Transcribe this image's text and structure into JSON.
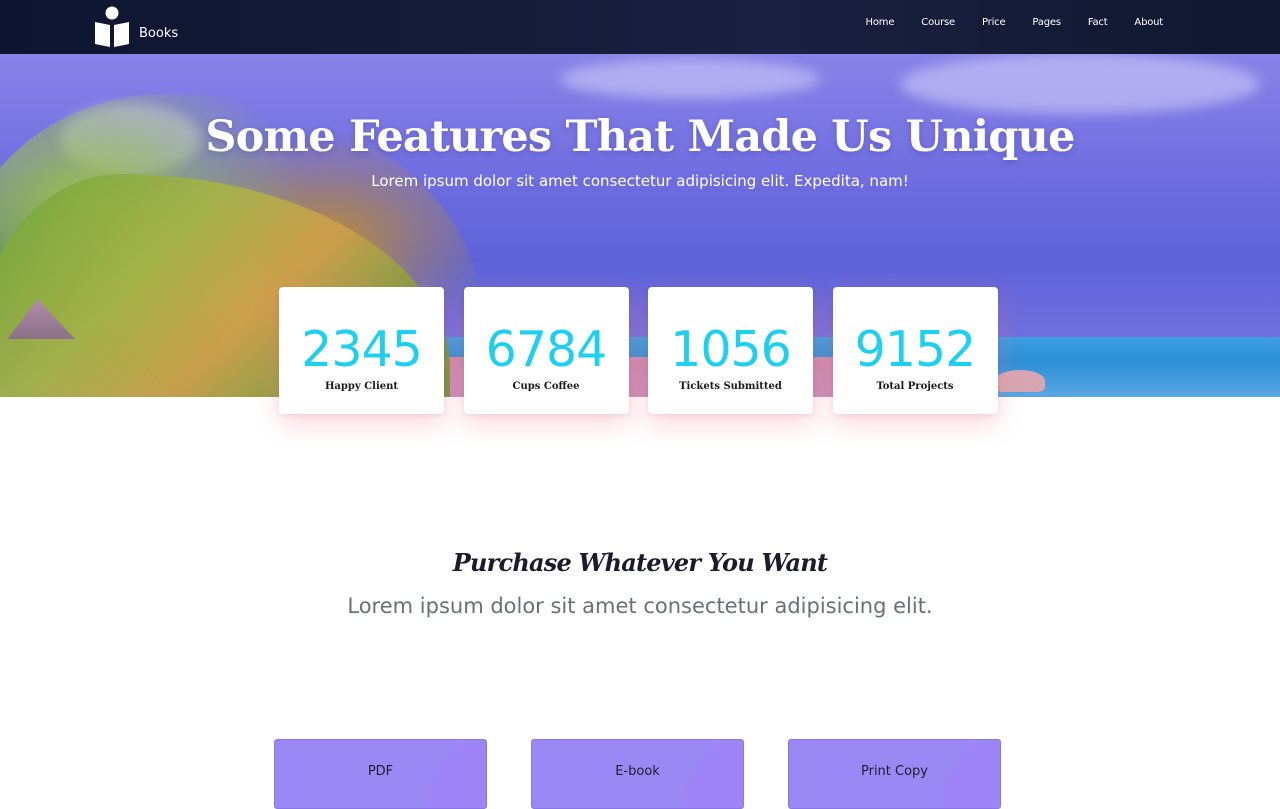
{
  "navbar": {
    "brand": "Books",
    "links": [
      "Home",
      "Course",
      "Price",
      "Pages",
      "Fact",
      "About"
    ]
  },
  "hero": {
    "title": "Some Features That Made Us Unique",
    "subtitle": "Lorem ipsum dolor sit amet consectetur adipisicing elit. Expedita, nam!"
  },
  "stats": [
    {
      "value": "2345",
      "label": "Happy Client"
    },
    {
      "value": "6784",
      "label": "Cups Coffee"
    },
    {
      "value": "1056",
      "label": "Tickets Submitted"
    },
    {
      "value": "9152",
      "label": "Total Projects"
    }
  ],
  "purchase": {
    "title": "Purchase Whatever You Want",
    "subtitle": "Lorem ipsum dolor sit amet consectetur adipisicing elit.",
    "options": [
      "PDF",
      "E-book",
      "Print Copy"
    ]
  },
  "colors": {
    "stat_value": "#1ed0ef",
    "option_bg": "#9a88f4",
    "navbar_bg": "#151c3a"
  }
}
